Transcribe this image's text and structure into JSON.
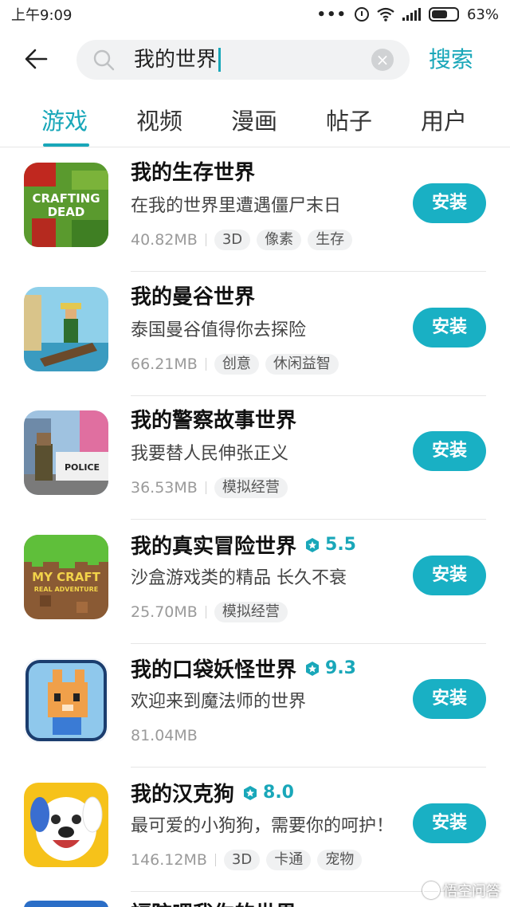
{
  "status_bar": {
    "time": "上午9:09",
    "dots": "•••",
    "battery": "63%",
    "battery_level": 0.63
  },
  "search": {
    "query": "我的世界",
    "search_button": "搜索"
  },
  "tabs": [
    {
      "label": "游戏",
      "active": true
    },
    {
      "label": "视频",
      "active": false
    },
    {
      "label": "漫画",
      "active": false
    },
    {
      "label": "帖子",
      "active": false
    },
    {
      "label": "用户",
      "active": false
    }
  ],
  "results": [
    {
      "title": "我的生存世界",
      "rating": "",
      "description": "在我的世界里遭遇僵尸末日",
      "size": "40.82MB",
      "tags": [
        "3D",
        "像素",
        "生存"
      ],
      "install": "安装",
      "icon": "crafting-dead-icon"
    },
    {
      "title": "我的曼谷世界",
      "rating": "",
      "description": "泰国曼谷值得你去探险",
      "size": "66.21MB",
      "tags": [
        "创意",
        "休闲益智"
      ],
      "install": "安装",
      "icon": "bangkok-boat-icon"
    },
    {
      "title": "我的警察故事世界",
      "rating": "",
      "description": "我要替人民伸张正义",
      "size": "36.53MB",
      "tags": [
        "模拟经营"
      ],
      "install": "安装",
      "icon": "police-icon"
    },
    {
      "title": "我的真实冒险世界",
      "rating": "5.5",
      "description": "沙盒游戏类的精品 长久不衰",
      "size": "25.70MB",
      "tags": [
        "模拟经营"
      ],
      "install": "安装",
      "icon": "my-craft-icon"
    },
    {
      "title": "我的口袋妖怪世界",
      "rating": "9.3",
      "description": "欢迎来到魔法师的世界",
      "size": "81.04MB",
      "tags": [],
      "install": "安装",
      "icon": "pocket-monster-icon"
    },
    {
      "title": "我的汉克狗",
      "rating": "8.0",
      "description": "最可爱的小狗狗，需要你的呵护！",
      "size": "146.12MB",
      "tags": [
        "3D",
        "卡通",
        "宠物"
      ],
      "install": "安装",
      "icon": "hank-dog-icon"
    }
  ],
  "partial_item_title": "福陀喂我你的世界",
  "watermark": "悟空问答",
  "colors": {
    "accent": "#19a7b9",
    "install": "#19b0c4"
  }
}
